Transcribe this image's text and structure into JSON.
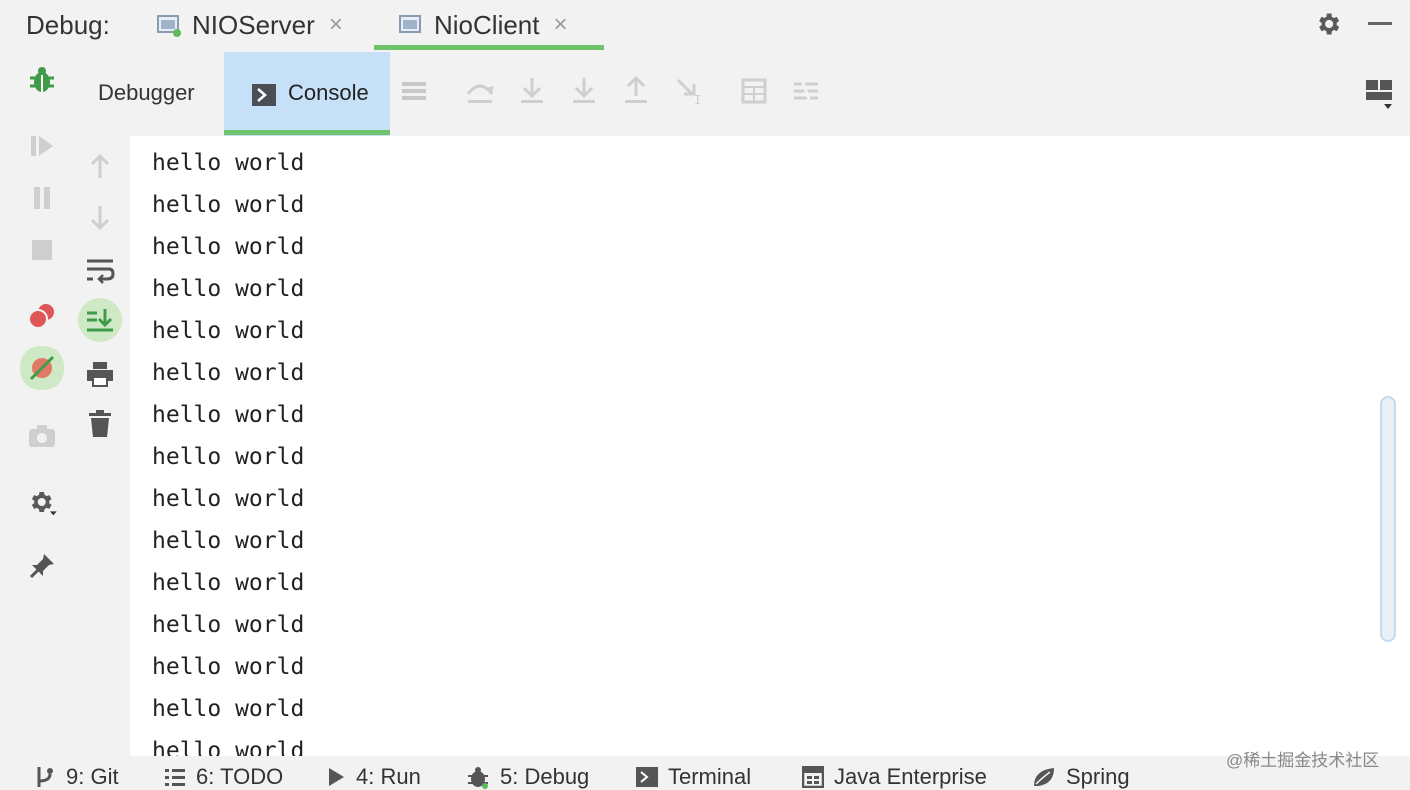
{
  "header": {
    "debug_label": "Debug:",
    "tabs": [
      {
        "label": "NIOServer",
        "icon": "run-config-icon",
        "closable": true
      },
      {
        "label": "NioClient",
        "icon": "run-config-icon",
        "closable": true,
        "active": true
      }
    ],
    "close_glyph": "×"
  },
  "toolbar": {
    "debugger_label": "Debugger",
    "console_label": "Console"
  },
  "console": {
    "lines": [
      "hello world",
      "hello world",
      "hello world",
      "hello world",
      "hello world",
      "hello world",
      "hello world",
      "hello world",
      "hello world",
      "hello world",
      "hello world",
      "hello world",
      "hello world",
      "hello world",
      "hello world"
    ]
  },
  "bottom_bar": {
    "items": [
      {
        "label": "9: Git",
        "icon": "git-branch-icon"
      },
      {
        "label": "6: TODO",
        "icon": "todo-list-icon"
      },
      {
        "label": "4: Run",
        "icon": "run-icon"
      },
      {
        "label": "5: Debug",
        "icon": "debug-bug-icon",
        "active": true
      },
      {
        "label": "Terminal",
        "icon": "terminal-icon"
      },
      {
        "label": "Java Enterprise",
        "icon": "java-enterprise-icon"
      },
      {
        "label": "Spring",
        "icon": "spring-leaf-icon"
      }
    ]
  },
  "watermark": "@稀土掘金技术社区",
  "colors": {
    "accent_green": "#6fc36a",
    "console_tab_bg": "#c6e0f7",
    "active_btn_bg": "#cfe9c6",
    "breakpoint_red": "#e05555"
  }
}
